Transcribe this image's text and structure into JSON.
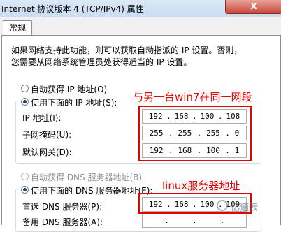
{
  "window": {
    "title": "Internet 协议版本 4 (TCP/IPv4) 属性",
    "close_label": "X"
  },
  "tabs": [
    {
      "label": "常规"
    }
  ],
  "description": {
    "line1": "如果网络支持此功能，则可以获取自动指派的 IP 设置。否则，",
    "line2": "您需要从网络系统管理员处获得适当的 IP 设置。"
  },
  "ip_section": {
    "auto_label": "自动获得 IP 地址(O)",
    "manual_label": "使用下面的 IP 地址(S):",
    "selected": "manual",
    "fields": [
      {
        "label": "IP 地址(I):",
        "octets": [
          "192",
          "168",
          "100",
          "108"
        ]
      },
      {
        "label": "子网掩码(U):",
        "octets": [
          "255",
          "255",
          "255",
          "0"
        ]
      },
      {
        "label": "默认网关(D):",
        "octets": [
          "192",
          "168",
          "100",
          "1"
        ]
      }
    ]
  },
  "dns_section": {
    "auto_label": "自动获得 DNS 服务器地址(B)",
    "manual_label": "使用下面的 DNS 服务器地址(E):",
    "selected": "manual",
    "fields": [
      {
        "label": "首选 DNS 服务器(P):",
        "octets": [
          "192",
          "168",
          "100",
          "109"
        ]
      },
      {
        "label": "备用 DNS 服务器(A):",
        "octets": [
          "",
          "",
          "",
          ""
        ]
      }
    ]
  },
  "annotations": {
    "ip_note": "与另一台win7在同一网段",
    "dns_note": "linux服务器地址",
    "color": "#e60000"
  },
  "watermark": {
    "text": "亿速云"
  }
}
